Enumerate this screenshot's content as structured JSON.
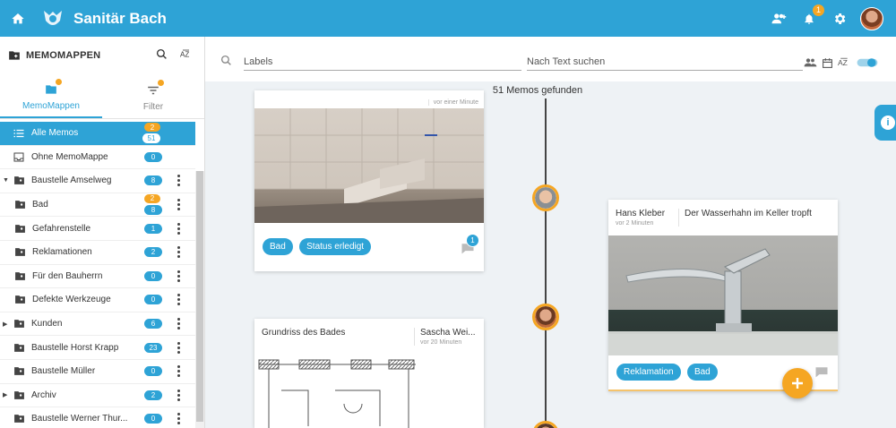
{
  "app": {
    "title": "Sanitär Bach",
    "notifications": "1"
  },
  "sidebar": {
    "heading": "MEMOMAPPEN",
    "tabs": [
      {
        "label": "MemoMappen"
      },
      {
        "label": "Filter"
      }
    ],
    "items": [
      {
        "label": "Alle Memos",
        "count": "51",
        "extra": "2"
      },
      {
        "label": "Ohne MemoMappe",
        "count": "0"
      },
      {
        "label": "Baustelle Amselweg",
        "count": "8"
      },
      {
        "label": "Bad",
        "count": "8",
        "extra": "2"
      },
      {
        "label": "Gefahrenstelle",
        "count": "1"
      },
      {
        "label": "Reklamationen",
        "count": "2"
      },
      {
        "label": "Für den Bauherrn",
        "count": "0"
      },
      {
        "label": "Defekte Werkzeuge",
        "count": "0"
      },
      {
        "label": "Kunden",
        "count": "6"
      },
      {
        "label": "Baustelle Horst Krapp",
        "count": "23"
      },
      {
        "label": "Baustelle Müller",
        "count": "0"
      },
      {
        "label": "Archiv",
        "count": "2"
      },
      {
        "label": "Baustelle Werner Thur...",
        "count": "0"
      }
    ]
  },
  "filters": {
    "labels_placeholder": "Labels",
    "text_placeholder": "Nach Text suchen"
  },
  "main": {
    "found": "51 Memos gefunden",
    "cards": [
      {
        "time": "vor einer Minute",
        "tags": [
          "Bad",
          "Status erledigt"
        ],
        "comments": "1"
      },
      {
        "author": "Hans Kleber",
        "time": "vor 2 Minuten",
        "title": "Der Wasserhahn im Keller tropft",
        "tags": [
          "Reklamation",
          "Bad"
        ]
      },
      {
        "title": "Grundriss des Bades",
        "author": "Sascha Wei...",
        "time": "vor 20 Minuten"
      }
    ]
  }
}
